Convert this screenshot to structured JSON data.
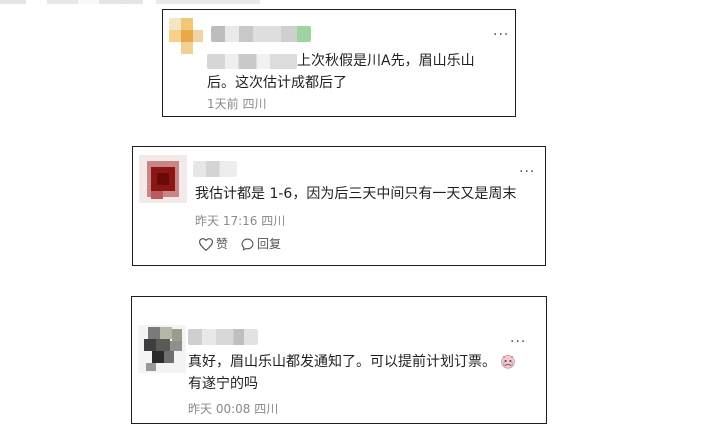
{
  "comments": [
    {
      "content_line1_tail": "上次秋假是川A先，眉山乐山",
      "content_line2": "后。这次估计成都后了",
      "time": "1天前",
      "location": "四川"
    },
    {
      "content": "我估计都是 1-6，因为后三天中间只有一天又是周末",
      "time": "昨天 17:16",
      "location": "四川",
      "like_label": "赞",
      "reply_label": "回复"
    },
    {
      "content_line1": "真好，眉山乐山都发通知了。可以提前计划订票。",
      "content_line2": "有遂宁的吗",
      "time": "昨天 00:08",
      "location": "四川"
    }
  ],
  "icons": {
    "more": "more-horizontal-icon",
    "like": "heart-outline-icon",
    "reply": "speech-bubble-icon",
    "emoji": "crying-face-emoji"
  },
  "more_glyph": "···"
}
